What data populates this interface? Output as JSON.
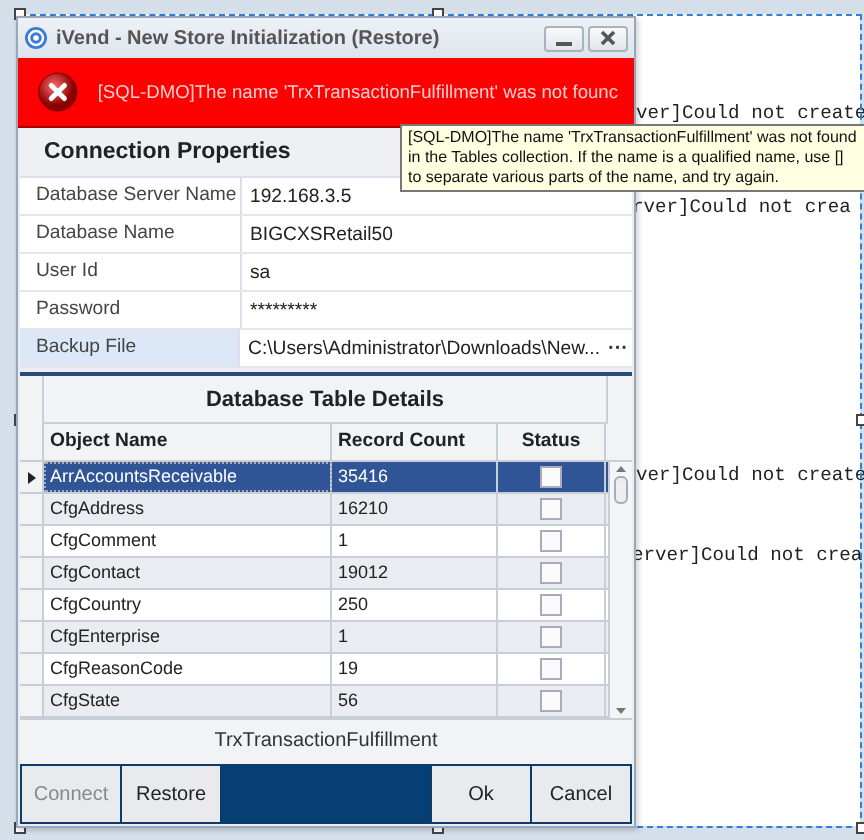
{
  "window": {
    "title": "iVend - New Store Initialization (Restore)"
  },
  "error_banner": {
    "message": "[SQL-DMO]The name 'TrxTransactionFulfillment' was not founc"
  },
  "tooltip": {
    "text": "[SQL-DMO]The name 'TrxTransactionFulfillment' was not found in the Tables collection.  If the name is a qualified name, use [] to separate various parts of the name, and try again."
  },
  "connection_properties": {
    "title": "Connection Properties",
    "fields": [
      {
        "label": "Database Server Name",
        "value": "192.168.3.5",
        "selected": false
      },
      {
        "label": "Database Name",
        "value": "BIGCXSRetail50",
        "selected": false
      },
      {
        "label": "User Id",
        "value": "sa",
        "selected": false
      },
      {
        "label": "Password",
        "value": "*********",
        "selected": false
      },
      {
        "label": "Backup File",
        "value": "C:\\Users\\Administrator\\Downloads\\New...",
        "selected": true,
        "button": "···"
      }
    ]
  },
  "table": {
    "title": "Database Table Details",
    "columns": [
      "Object Name",
      "Record Count",
      "Status"
    ],
    "rows": [
      {
        "object_name": "ArrAccountsReceivable",
        "record_count": "35416",
        "checked": false,
        "selected": true
      },
      {
        "object_name": "CfgAddress",
        "record_count": "16210",
        "checked": false,
        "selected": false
      },
      {
        "object_name": "CfgComment",
        "record_count": "1",
        "checked": false,
        "selected": false
      },
      {
        "object_name": "CfgContact",
        "record_count": "19012",
        "checked": false,
        "selected": false
      },
      {
        "object_name": "CfgCountry",
        "record_count": "250",
        "checked": false,
        "selected": false
      },
      {
        "object_name": "CfgEnterprise",
        "record_count": "1",
        "checked": false,
        "selected": false
      },
      {
        "object_name": "CfgReasonCode",
        "record_count": "19",
        "checked": false,
        "selected": false
      },
      {
        "object_name": "CfgState",
        "record_count": "56",
        "checked": false,
        "selected": false
      }
    ]
  },
  "current_object": "TrxTransactionFulfillment",
  "buttons_left": [
    {
      "label": "Connect",
      "disabled": true
    },
    {
      "label": "Restore",
      "disabled": false
    }
  ],
  "buttons_right": [
    {
      "label": "Ok",
      "disabled": false
    },
    {
      "label": "Cancel",
      "disabled": false
    }
  ],
  "background_lines": [
    "ver]Could not create",
    "rver]Could not crea",
    "ver]Could not create",
    "erver]Could not crea"
  ]
}
